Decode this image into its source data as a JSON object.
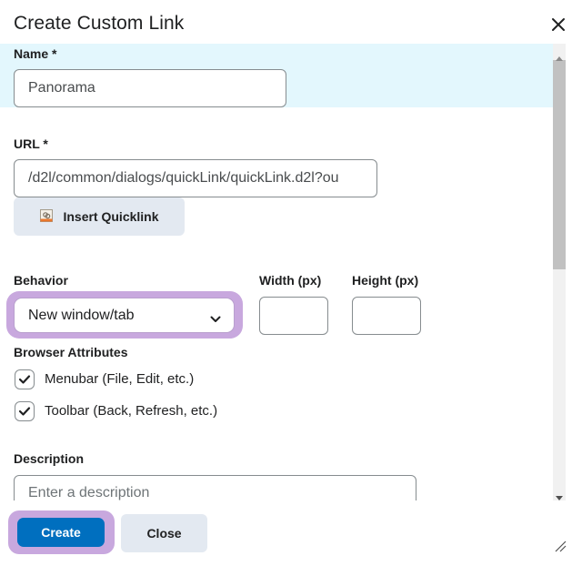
{
  "dialog": {
    "title": "Create Custom Link",
    "close_icon": "close-icon"
  },
  "form": {
    "name": {
      "label": "Name",
      "required_mark": "*",
      "value": "Panorama"
    },
    "url": {
      "label": "URL",
      "required_mark": "*",
      "value": "/d2l/common/dialogs/quickLink/quickLink.d2l?ou"
    },
    "insert_quicklink": {
      "label": "Insert Quicklink",
      "icon": "quicklink-icon"
    },
    "behavior": {
      "label": "Behavior",
      "selected": "New window/tab",
      "icon": "chevron-down-icon"
    },
    "width": {
      "label": "Width (px)",
      "value": ""
    },
    "height": {
      "label": "Height (px)",
      "value": ""
    },
    "browser_attributes": {
      "label": "Browser Attributes",
      "options": [
        {
          "label": "Menubar (File, Edit, etc.)",
          "checked": true
        },
        {
          "label": "Toolbar (Back, Refresh, etc.)",
          "checked": true
        }
      ]
    },
    "description": {
      "label": "Description",
      "placeholder": "Enter a description"
    }
  },
  "footer": {
    "create_label": "Create",
    "close_label": "Close"
  },
  "colors": {
    "primary": "#006fbf",
    "focus_ring": "#c8a8de",
    "highlight": "#e3f7fd",
    "secondary_button": "#e3e9f1"
  }
}
